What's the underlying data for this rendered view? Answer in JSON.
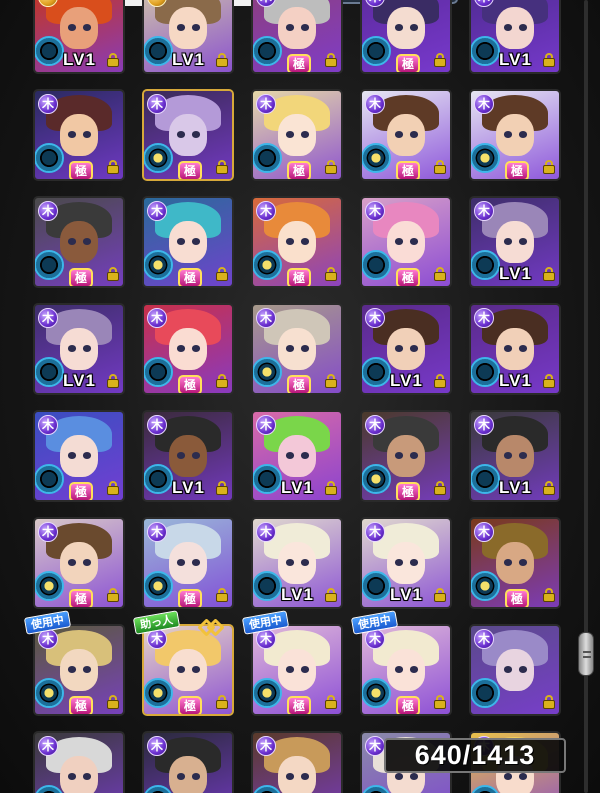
{
  "screen_title": "",
  "box_count": "640/1413",
  "colors": {
    "frame_purple": "#7d3cd6",
    "badge_wood": "#8e54f0",
    "orb_blue": "#3db7ea",
    "gold_frame": "#d7a93a",
    "background": "#161616"
  },
  "icons": {
    "element_badge": "wood-element-icon",
    "type_orb": "type-orb-icon",
    "lock": "lock-icon",
    "goku_mark": "goku-rank-badge",
    "link": "link-icon"
  },
  "tags": {
    "in_use": "使用中",
    "helper": "助っ人",
    "goku": "極",
    "element_glyph": "木"
  },
  "rows": [
    {
      "cards": [
        {
          "lv": "LV1",
          "elem": "fire",
          "gold": false,
          "goku": false,
          "star": false,
          "hair": "#d94e1c",
          "face": "#e8a07a",
          "bg": "#c7361a"
        },
        {
          "lv": "LV1",
          "elem": "fire",
          "gold": false,
          "goku": false,
          "star": false,
          "hair": "#8a6a4a",
          "face": "#f6d8c4",
          "bg": "#d2c7a8"
        },
        {
          "lv": "",
          "elem": "wood",
          "gold": false,
          "goku": true,
          "star": false,
          "hair": "#bdbdbd",
          "face": "#f4d0c4",
          "bg": "#8d3f7a"
        },
        {
          "lv": "",
          "elem": "wood",
          "gold": false,
          "goku": true,
          "star": false,
          "hair": "#3a2c64",
          "face": "#f4dcd0",
          "bg": "#5b2a9c"
        },
        {
          "lv": "LV1",
          "elem": "wood",
          "gold": false,
          "goku": false,
          "star": false,
          "hair": "#46307e",
          "face": "#f3d6d0",
          "bg": "#4e2a90"
        }
      ]
    },
    {
      "cards": [
        {
          "lv": "",
          "elem": "wood",
          "gold": false,
          "goku": true,
          "star": false,
          "hair": "#5a2a2a",
          "face": "#f1c8a4",
          "bg": "#2a2a60"
        },
        {
          "lv": "",
          "elem": "wood",
          "gold": true,
          "goku": true,
          "star": true,
          "hair": "#b49ad8",
          "face": "#d9c8e8",
          "bg": "#3a2a56"
        },
        {
          "lv": "",
          "elem": "wood",
          "gold": false,
          "goku": true,
          "star": false,
          "hair": "#f2d67a",
          "face": "#fae4d4",
          "bg": "#e6d8a8"
        },
        {
          "lv": "",
          "elem": "wood",
          "gold": false,
          "goku": true,
          "star": true,
          "hair": "#5e3a26",
          "face": "#f2d0b4",
          "bg": "#e6e6f2"
        },
        {
          "lv": "",
          "elem": "wood",
          "gold": false,
          "goku": true,
          "star": true,
          "hair": "#5e3a26",
          "face": "#f2d0b4",
          "bg": "#e6e6f2"
        }
      ]
    },
    {
      "cards": [
        {
          "lv": "",
          "elem": "wood",
          "gold": false,
          "goku": true,
          "star": false,
          "hair": "#3a3a3a",
          "face": "#8a5a3c",
          "bg": "#4a4a4a"
        },
        {
          "lv": "",
          "elem": "wood",
          "gold": false,
          "goku": true,
          "star": true,
          "hair": "#3fb8c8",
          "face": "#f8ddd2",
          "bg": "#2a6a9a"
        },
        {
          "lv": "",
          "elem": "wood",
          "gold": false,
          "goku": true,
          "star": true,
          "hair": "#e88a3a",
          "face": "#fae0cc",
          "bg": "#d86a3a"
        },
        {
          "lv": "",
          "elem": "wood",
          "gold": false,
          "goku": true,
          "star": false,
          "hair": "#e887c0",
          "face": "#fadcd6",
          "bg": "#d8a0c8"
        },
        {
          "lv": "LV1",
          "elem": "wood",
          "gold": false,
          "goku": false,
          "star": false,
          "hair": "#9a86b8",
          "face": "#f6dcd4",
          "bg": "#3e2e6a"
        }
      ]
    },
    {
      "cards": [
        {
          "lv": "LV1",
          "elem": "wood",
          "gold": false,
          "goku": false,
          "star": false,
          "hair": "#9a86b8",
          "face": "#f6dcd4",
          "bg": "#3e2e6a"
        },
        {
          "lv": "",
          "elem": "wood",
          "gold": false,
          "goku": true,
          "star": false,
          "hair": "#e84a5a",
          "face": "#fadcd2",
          "bg": "#c8304a"
        },
        {
          "lv": "",
          "elem": "wood",
          "gold": false,
          "goku": true,
          "star": true,
          "hair": "#cfc6b8",
          "face": "#f7e0d0",
          "bg": "#a89a8a"
        },
        {
          "lv": "LV1",
          "elem": "wood",
          "gold": false,
          "goku": false,
          "star": false,
          "hair": "#4a2e22",
          "face": "#f1d0b8",
          "bg": "#5a2a8a"
        },
        {
          "lv": "LV1",
          "elem": "wood",
          "gold": false,
          "goku": false,
          "star": false,
          "hair": "#4a2e22",
          "face": "#f1d0b8",
          "bg": "#5a2a8a"
        }
      ]
    },
    {
      "cards": [
        {
          "lv": "",
          "elem": "wood",
          "gold": false,
          "goku": true,
          "star": false,
          "hair": "#5a8ee0",
          "face": "#f4dcd4",
          "bg": "#3a4ec0"
        },
        {
          "lv": "LV1",
          "elem": "wood",
          "gold": false,
          "goku": false,
          "star": false,
          "hair": "#2a2a2a",
          "face": "#8a5a3a",
          "bg": "#3a2a3a"
        },
        {
          "lv": "LV1",
          "elem": "wood",
          "gold": false,
          "goku": false,
          "star": false,
          "hair": "#7ad64a",
          "face": "#f3c8d8",
          "bg": "#d86aa8"
        },
        {
          "lv": "",
          "elem": "wood",
          "gold": false,
          "goku": true,
          "star": true,
          "hair": "#3a3a3a",
          "face": "#c89a7a",
          "bg": "#4a3a2a"
        },
        {
          "lv": "LV1",
          "elem": "wood",
          "gold": false,
          "goku": false,
          "star": false,
          "hair": "#2a2a2a",
          "face": "#b8886a",
          "bg": "#3a3a3a"
        }
      ]
    },
    {
      "cards": [
        {
          "lv": "",
          "elem": "wood",
          "gold": false,
          "goku": true,
          "star": true,
          "hair": "#6a4a2e",
          "face": "#f2d4bc",
          "bg": "#d8c8c8"
        },
        {
          "lv": "",
          "elem": "wood",
          "gold": false,
          "goku": true,
          "star": true,
          "hair": "#c8d8e8",
          "face": "#f4e0dc",
          "bg": "#9ab8d8"
        },
        {
          "lv": "LV1",
          "elem": "wood",
          "gold": false,
          "goku": false,
          "star": false,
          "hair": "#f0ecd8",
          "face": "#fae6dc",
          "bg": "#e0d8ce"
        },
        {
          "lv": "LV1",
          "elem": "wood",
          "gold": false,
          "goku": false,
          "star": false,
          "hair": "#f0ecd8",
          "face": "#fae6dc",
          "bg": "#e0d8ce"
        },
        {
          "lv": "",
          "elem": "wood",
          "gold": false,
          "goku": true,
          "star": true,
          "hair": "#8a6a2a",
          "face": "#d8a884",
          "bg": "#7a3a1a"
        }
      ]
    },
    {
      "cards": [
        {
          "lv": "",
          "elem": "wood",
          "gold": false,
          "goku": true,
          "star": true,
          "hair": "#d8c07a",
          "face": "#f2d8c0",
          "bg": "#5a5a3a",
          "tag": "in_use"
        },
        {
          "lv": "",
          "elem": "wood",
          "gold": true,
          "goku": true,
          "star": true,
          "hair": "#f2c86a",
          "face": "#f8ded0",
          "bg": "#e6d4c4",
          "tag": "helper",
          "link": true
        },
        {
          "lv": "",
          "elem": "wood",
          "gold": false,
          "goku": true,
          "star": true,
          "hair": "#f2ead0",
          "face": "#fae2d8",
          "bg": "#e0b8d8",
          "tag": "in_use"
        },
        {
          "lv": "",
          "elem": "wood",
          "gold": false,
          "goku": true,
          "star": true,
          "hair": "#f2ead0",
          "face": "#fae2d8",
          "bg": "#e0b8d8",
          "tag": "in_use"
        },
        {
          "lv": "",
          "elem": "wood",
          "gold": false,
          "goku": false,
          "star": false,
          "hair": "#9a8ac8",
          "face": "#e8d4e0",
          "bg": "#5a4a8a"
        }
      ]
    },
    {
      "cards": [
        {
          "lv": "",
          "elem": "wood",
          "gold": false,
          "goku": false,
          "star": false,
          "hair": "#d8d8d8",
          "face": "#f0d0c0",
          "bg": "#3a3a3a"
        },
        {
          "lv": "",
          "elem": "wood",
          "gold": false,
          "goku": false,
          "star": false,
          "hair": "#2a2a2a",
          "face": "#d8b090",
          "bg": "#2a2a3a"
        },
        {
          "lv": "",
          "elem": "wood",
          "gold": false,
          "goku": false,
          "star": false,
          "hair": "#c89a5a",
          "face": "#f4d8c4",
          "bg": "#5a3a2a"
        },
        {
          "lv": "",
          "elem": "wood",
          "gold": false,
          "goku": false,
          "star": false,
          "hair": "#e8e0d8",
          "face": "#f4dcd0",
          "bg": "#8a8aa8"
        },
        {
          "lv": "",
          "elem": "wood",
          "gold": false,
          "goku": false,
          "star": false,
          "hair": "#f2d05a",
          "face": "#f8dccc",
          "bg": "#e8c04a"
        }
      ]
    }
  ]
}
